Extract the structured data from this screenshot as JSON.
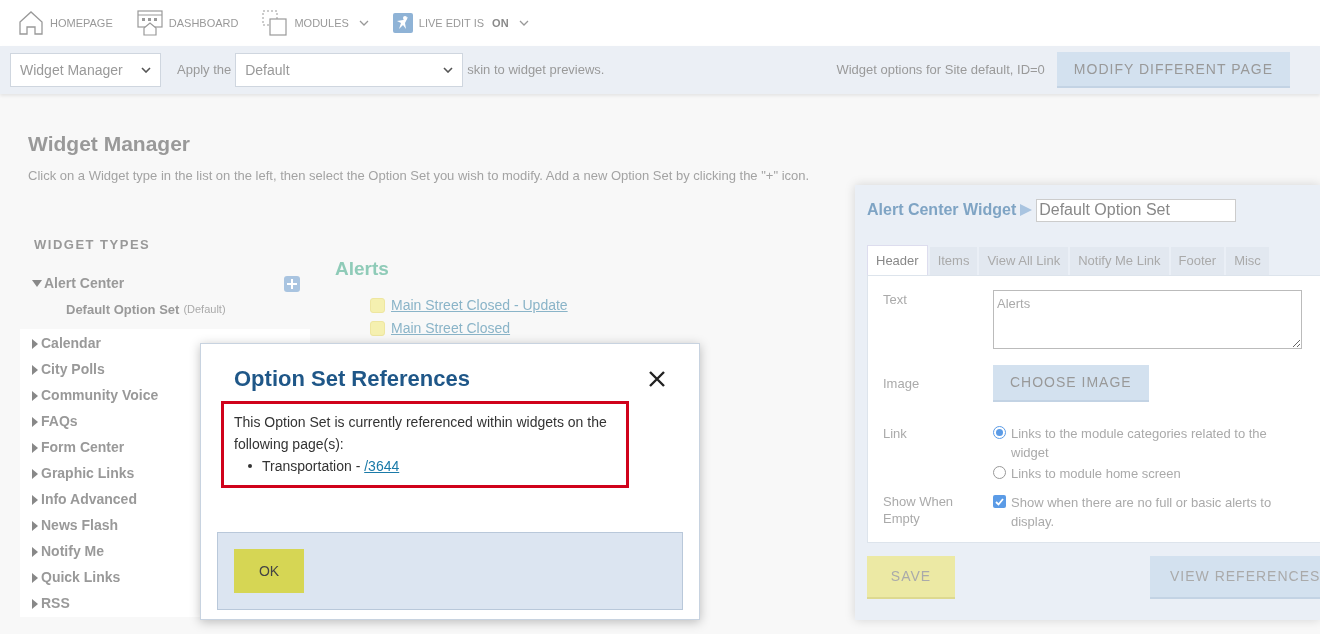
{
  "nav": [
    {
      "kind": "home",
      "label": "HOMEPAGE"
    },
    {
      "kind": "dashboard",
      "label": "DASHBOARD"
    },
    {
      "kind": "modules",
      "label": "MODULES",
      "dropdown": true
    },
    {
      "kind": "live",
      "label": "LIVE EDIT IS",
      "value": "ON",
      "dropdown": true
    }
  ],
  "toolbar": {
    "page_select": "Widget Manager",
    "apply_label": "Apply the",
    "skin_select": "Default",
    "skin_suffix": "skin to widget previews.",
    "info": "Widget options for Site default, ID=0",
    "button": "MODIFY DIFFERENT PAGE"
  },
  "heading": "Widget Manager",
  "description": "Click on a Widget type in the list on the left, then select the Option Set you wish to modify. Add a new Option Set by clicking the \"+\" icon.",
  "widget_types": {
    "title": "WIDGET TYPES",
    "items": [
      {
        "label": "Alert Center",
        "expanded": true,
        "children": [
          {
            "label": "Default Option Set",
            "note": "(Default)"
          }
        ]
      },
      {
        "label": "Calendar",
        "expanded": false
      },
      {
        "label": "City Polls",
        "expanded": false
      },
      {
        "label": "Community Voice",
        "expanded": false
      },
      {
        "label": "FAQs",
        "expanded": false
      },
      {
        "label": "Form Center",
        "expanded": false
      },
      {
        "label": "Graphic Links",
        "expanded": false
      },
      {
        "label": "Info Advanced",
        "expanded": false
      },
      {
        "label": "News Flash",
        "expanded": false
      },
      {
        "label": "Notify Me",
        "expanded": false
      },
      {
        "label": "Quick Links",
        "expanded": false
      },
      {
        "label": "RSS",
        "expanded": false
      }
    ]
  },
  "alerts": {
    "title": "Alerts",
    "items": [
      "Main Street Closed - Update",
      "Main Street Closed"
    ]
  },
  "option_panel": {
    "title": "Alert Center Widget",
    "name_value": "Default Option Set",
    "tabs": [
      {
        "label": "Header",
        "selected": true
      },
      {
        "label": "Items",
        "selected": false
      },
      {
        "label": "View All Link",
        "selected": false
      },
      {
        "label": "Notify Me Link",
        "selected": false
      },
      {
        "label": "Footer",
        "selected": false
      },
      {
        "label": "Misc",
        "selected": false
      }
    ],
    "text_label": "Text",
    "text_value": "Alerts",
    "image_label": "Image",
    "image_button": "CHOOSE IMAGE",
    "link_label": "Link",
    "link_options": [
      {
        "label": "Links to the module categories related to the widget",
        "selected": true
      },
      {
        "label": "Links to module home screen",
        "selected": false
      }
    ],
    "empty_label": "Show When Empty",
    "empty_option": {
      "label": "Show when there are no full or basic alerts to display.",
      "checked": true
    },
    "save": "SAVE",
    "view_references": "VIEW REFERENCES"
  },
  "modal": {
    "title": "Option Set References",
    "message": "This Option Set is currently referenced within widgets on the following page(s):",
    "references": [
      {
        "page": "Transportation - ",
        "link": "/3644"
      }
    ],
    "ok": "OK"
  }
}
